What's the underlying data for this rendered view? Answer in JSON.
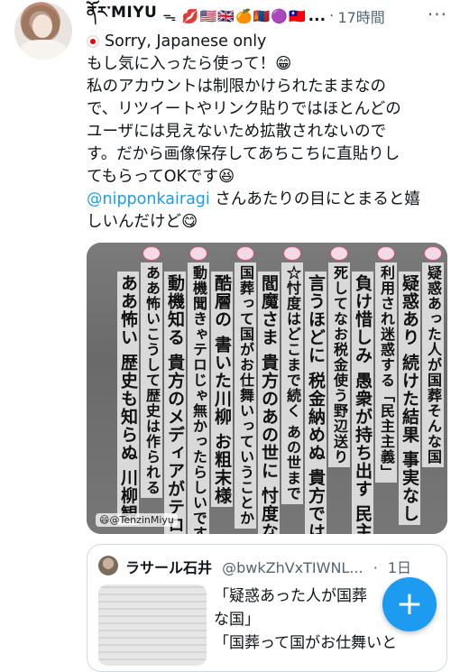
{
  "tweet": {
    "display_name": "ནོར་MIYU",
    "name_emojis": "ᯓ 💋🇺🇸🇬🇧🍊🇲🇳🟣🇹🇼",
    "name_ellipsis": "...",
    "separator": "·",
    "time": "17時間",
    "more_label": "···",
    "lines": [
      "Sorry, Japanese only",
      "もし気に入ったら使って！😁",
      "私のアカウントは制限かけられたままなの",
      "で、リツイートやリンク貼りではほとんどの",
      "ユーザには見えないため拡散されないので",
      "す。だから画像保存してあちこちに直貼りし",
      "てもらってOKです😆"
    ],
    "mention": "@nipponkairagi",
    "mention_rest": " さんあたりの目にとまると嬉",
    "last_line": "しいんだけど😋"
  },
  "image": {
    "columns": [
      "疑惑あった人が国葬そんな国",
      "疑惑あり 続けた結果 事実なし",
      "利用され迷惑する「民主主義」",
      "負け惜しみ 愚衆が持ち出す 民主主義",
      "死してなお税金使う野辺送り",
      "言うほどに 税金納めぬ 貴方では？",
      "☆忖度はどこまで続く あの世まで",
      "閻魔さま 貴方のあの世に 忖度なし",
      "国葬って国がお仕舞いっていうことか",
      "酷層の 書いた川柳 お粗末様",
      "動機聞きゃテロじゃ無かったらしいです",
      "動機知る 貴方のメディアがテロなのよ",
      "ああ怖いこうして歴史は作られる",
      "ああ怖い 歴史も知らぬ 川柳観"
    ],
    "watermark": "😄@TenzinMiyu"
  },
  "quote": {
    "name": "ラサール石井",
    "handle": "@bwkZhVxTIWNL...",
    "sep": "·",
    "time": "1日",
    "line1": "「疑惑あった人が国葬",
    "line2": "な国」",
    "line3": "「国葬って国がお仕舞いと"
  },
  "fab": {
    "label": "+"
  }
}
